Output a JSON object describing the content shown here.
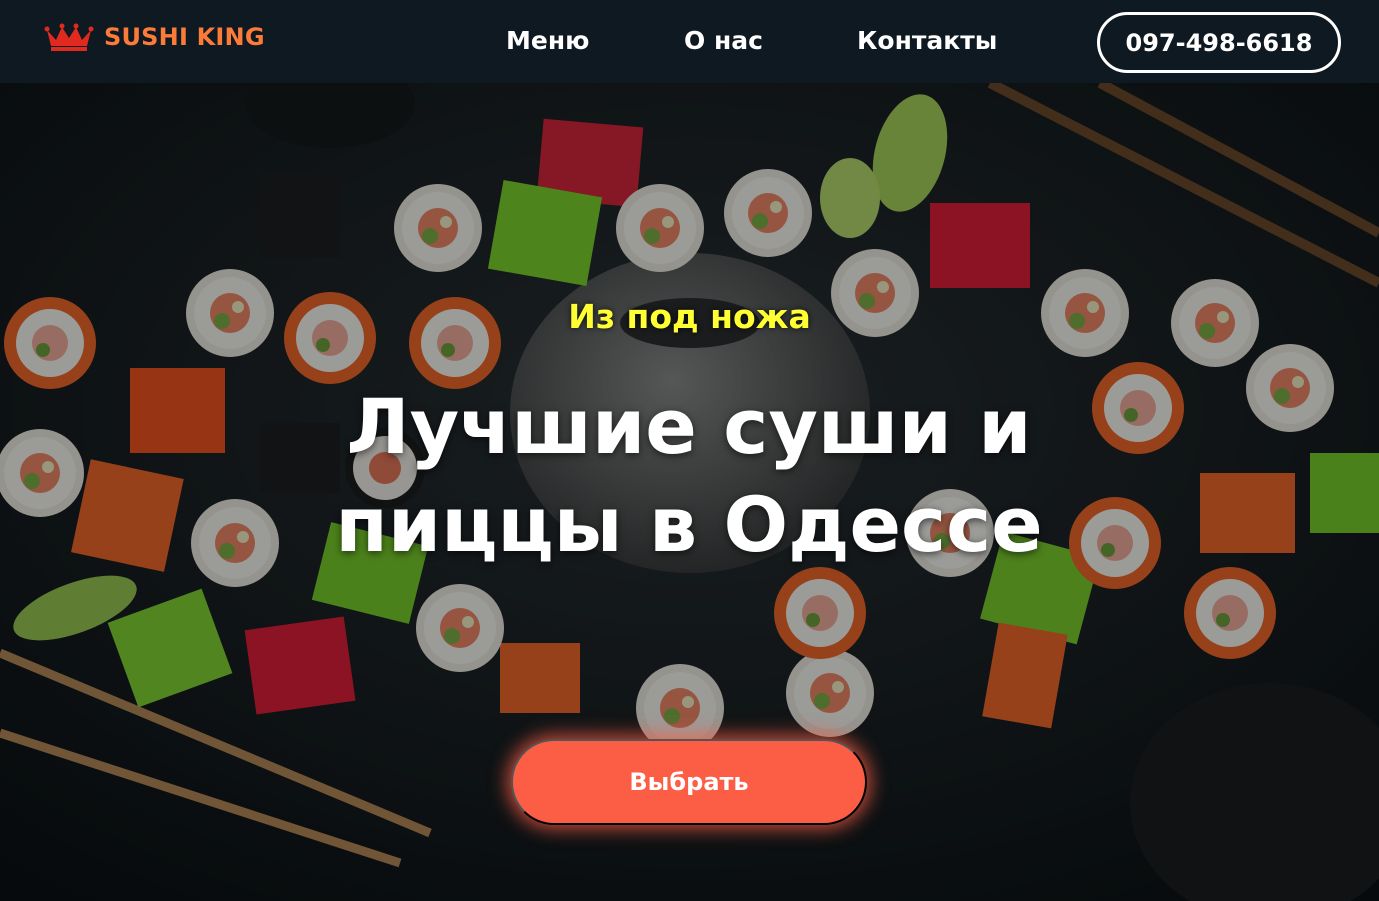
{
  "header": {
    "logo_text": "SUSHI KING",
    "nav": {
      "menu": "Меню",
      "about": "О нас",
      "contacts": "Контакты"
    },
    "phone": "097-498-6618"
  },
  "hero": {
    "subtitle": "Из под ножа",
    "headline": "Лучшие суши и пиццы в Одессе",
    "cta_label": "Выбрать"
  },
  "colors": {
    "header_bg": "#0f1921",
    "logo_accent": "#fd7b39",
    "subtitle": "#ffff33",
    "cta_bg": "#fc5e45"
  },
  "icons": [
    "crown-icon"
  ]
}
